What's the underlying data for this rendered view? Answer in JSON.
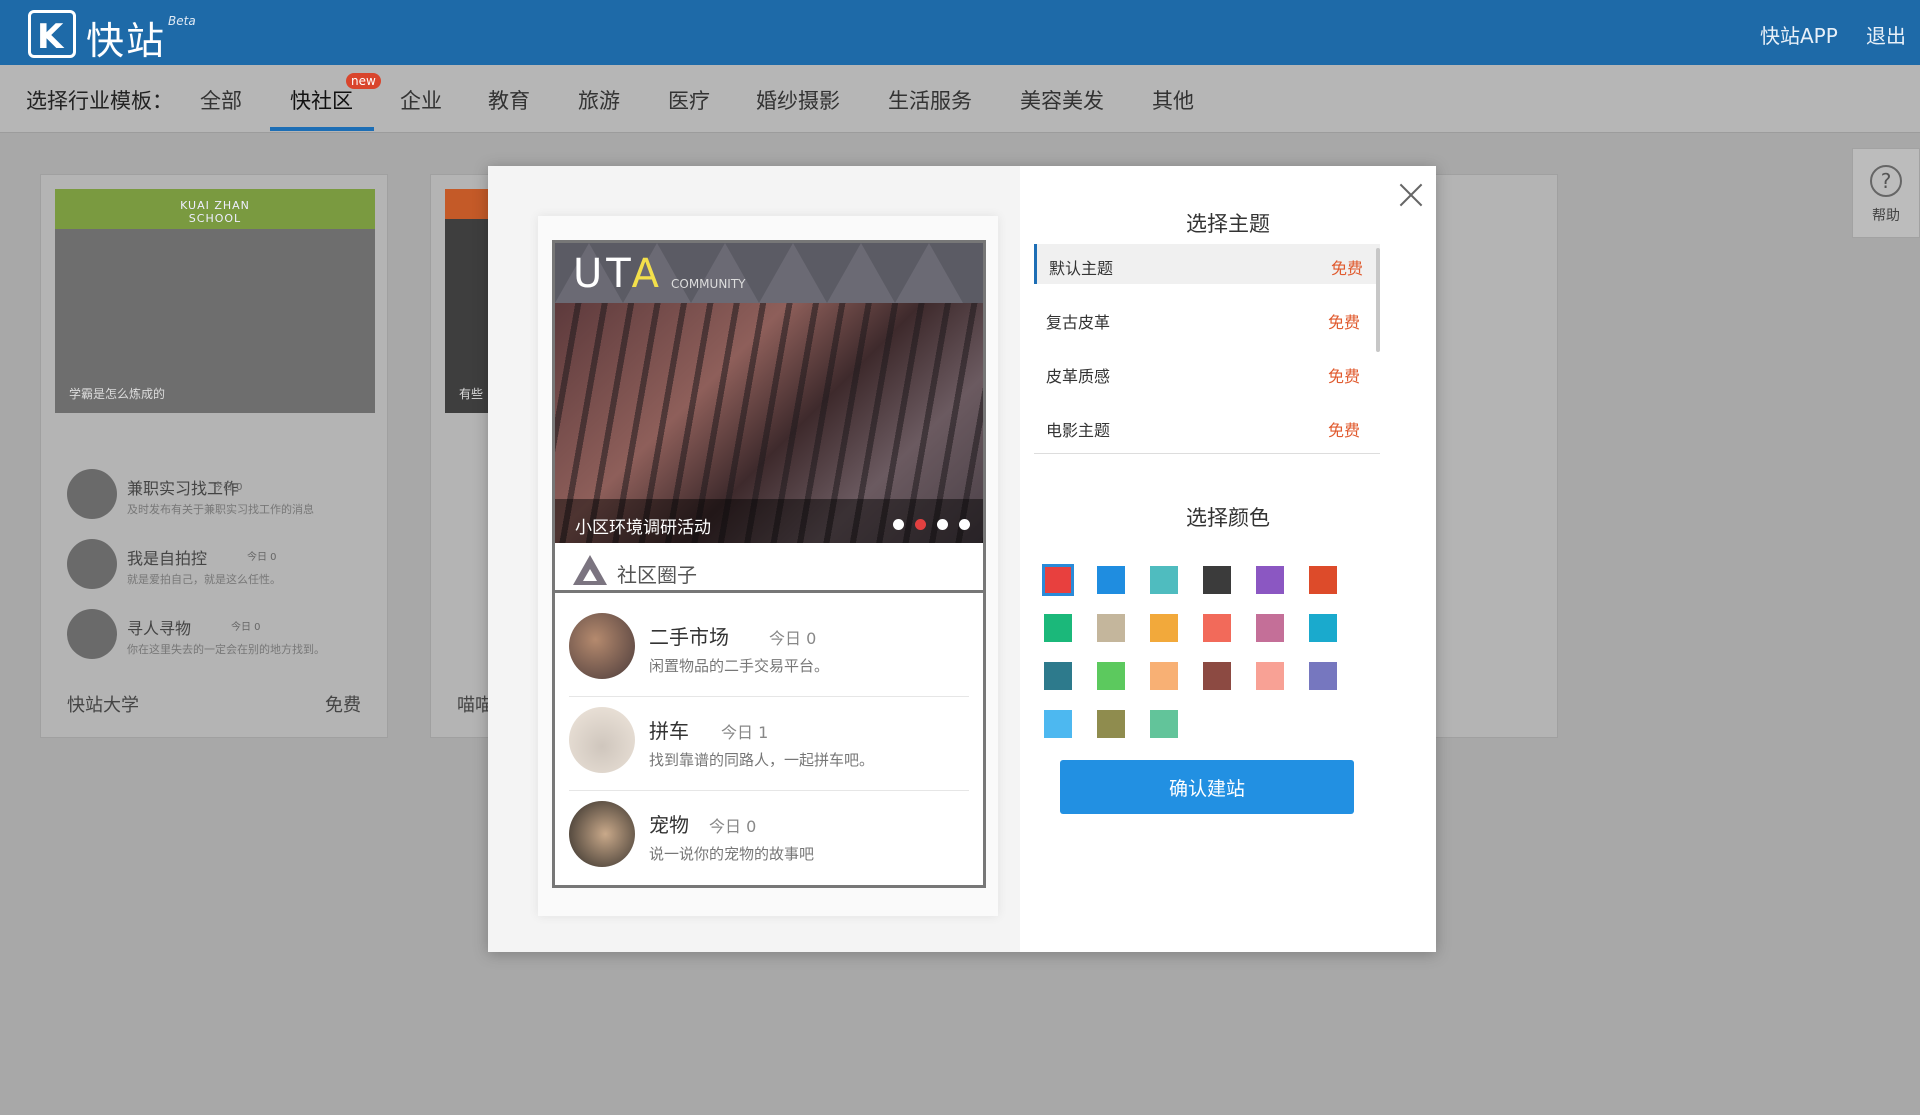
{
  "header": {
    "logo_letter": "K",
    "brand": "快站",
    "beta": "Beta",
    "app_link": "快站APP",
    "logout_link": "退出"
  },
  "categories": {
    "label": "选择行业模板：",
    "items": [
      "全部",
      "快社区",
      "企业",
      "教育",
      "旅游",
      "医疗",
      "婚纱摄影",
      "生活服务",
      "美容美发",
      "其他"
    ],
    "new_badge": "new"
  },
  "bg_cards": {
    "card1": {
      "banner_title": "KUAI ZHAN",
      "banner_sub": "SCHOOL",
      "caption": "学霸是怎么炼成的",
      "items": [
        {
          "title": "兼职实习找工作",
          "meta": "今日 0",
          "desc": "及时发布有关于兼职实习找工作的消息"
        },
        {
          "title": "我是自拍控",
          "meta": "今日 0",
          "desc": "就是爱拍自己，就是这么任性。"
        },
        {
          "title": "寻人寻物",
          "meta": "今日 0",
          "desc": "你在这里失去的一定会在别的地方找到。"
        }
      ],
      "name": "快站大学",
      "price": "免费"
    },
    "card2": {
      "caption": "有些",
      "name": "喵喵"
    }
  },
  "help": {
    "icon": "?",
    "label": "帮助"
  },
  "preview": {
    "logo_main": "UT",
    "logo_a": "A",
    "logo_sub": "COMMUNITY",
    "banner_caption": "小区环境调研活动",
    "section_title": "社区圈子",
    "items": [
      {
        "title": "二手市场",
        "meta": "今日 0",
        "desc": "闲置物品的二手交易平台。"
      },
      {
        "title": "拼车",
        "meta": "今日 1",
        "desc": "找到靠谱的同路人，一起拼车吧。"
      },
      {
        "title": "宠物",
        "meta": "今日 0",
        "desc": "说一说你的宠物的故事吧"
      }
    ]
  },
  "themes": {
    "title": "选择主题",
    "items": [
      {
        "name": "默认主题",
        "price": "免费"
      },
      {
        "name": "复古皮革",
        "price": "免费"
      },
      {
        "name": "皮革质感",
        "price": "免费"
      },
      {
        "name": "电影主题",
        "price": "免费"
      }
    ]
  },
  "colors": {
    "title": "选择颜色",
    "swatches": [
      "#e8403e",
      "#1f8de0",
      "#4fbcbf",
      "#3b3b3b",
      "#8b57c2",
      "#dd4b2a",
      "#1bb87a",
      "#c4b69c",
      "#f2a93b",
      "#f26a5a",
      "#c46f98",
      "#1aaacd",
      "#2d7a8c",
      "#5cc95e",
      "#f8b074",
      "#8c4a42",
      "#f8a195",
      "#7677bf",
      "#4db8f0",
      "#8f8c4e",
      "#62c49a"
    ],
    "selected_index": 0
  },
  "confirm_label": "确认建站"
}
